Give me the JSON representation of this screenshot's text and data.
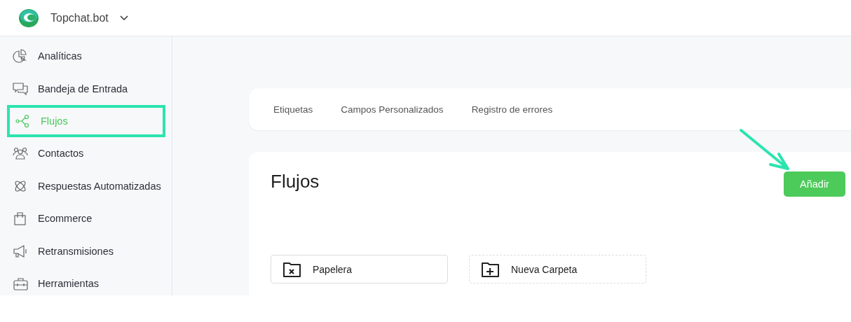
{
  "header": {
    "brand": "Topchat.bot"
  },
  "sidebar": {
    "items": [
      {
        "label": "Analíticas",
        "kind": "pie",
        "selected": false,
        "highlighted": false
      },
      {
        "label": "Bandeja de Entrada",
        "kind": "chat",
        "selected": false,
        "highlighted": false
      },
      {
        "label": "Flujos",
        "kind": "flow",
        "selected": true,
        "highlighted": true
      },
      {
        "label": "Contactos",
        "kind": "people",
        "selected": false,
        "highlighted": false
      },
      {
        "label": "Respuestas Automatizadas",
        "kind": "atom",
        "selected": false,
        "highlighted": false
      },
      {
        "label": "Ecommerce",
        "kind": "bag",
        "selected": false,
        "highlighted": false
      },
      {
        "label": "Retransmisiones",
        "kind": "megaphone",
        "selected": false,
        "highlighted": false
      },
      {
        "label": "Herramientas",
        "kind": "toolbox",
        "selected": false,
        "highlighted": false
      }
    ]
  },
  "tabs": [
    {
      "label": "Etiquetas"
    },
    {
      "label": "Campos Personalizados"
    },
    {
      "label": "Registro de errores"
    }
  ],
  "content": {
    "title": "Flujos",
    "add_button": "Añadir",
    "folders": [
      {
        "label": "Papelera",
        "kind": "trash"
      },
      {
        "label": "Nueva Carpeta",
        "kind": "new"
      }
    ]
  }
}
